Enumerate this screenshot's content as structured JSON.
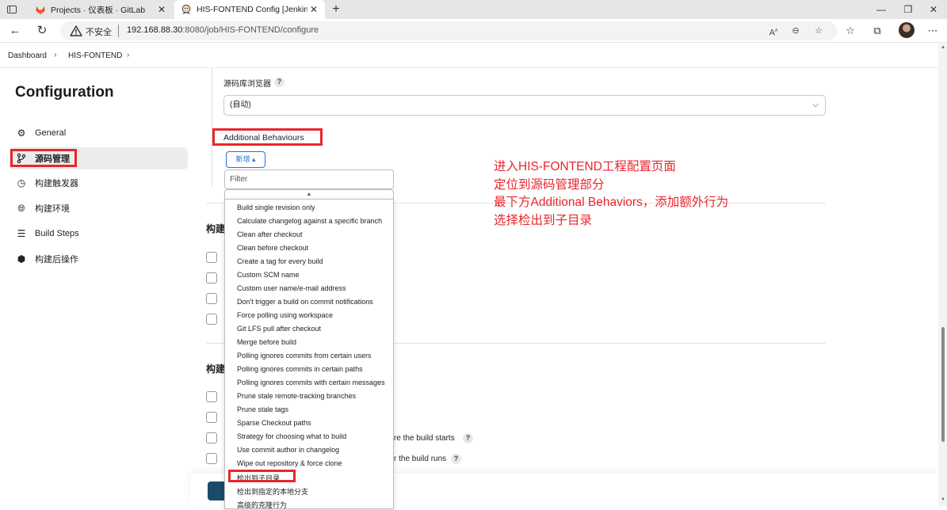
{
  "browser": {
    "tabs": [
      {
        "title": "Projects · 仪表板 · GitLab",
        "favicon": "gitlab-fox-icon"
      },
      {
        "title": "HIS-FONTEND Config [Jenkins]",
        "favicon": "jenkins-butler-icon"
      }
    ],
    "address": {
      "insecure_label": "不安全",
      "host": "192.168.88.30",
      "path": ":8080/job/HIS-FONTEND/configure"
    }
  },
  "breadcrumb": {
    "items": [
      "Dashboard",
      "HIS-FONTEND"
    ]
  },
  "sidebar": {
    "title": "Configuration",
    "items": [
      {
        "label": "General",
        "icon": "gear-icon"
      },
      {
        "label": "源码管理",
        "icon": "branch-icon",
        "active": true
      },
      {
        "label": "构建触发器",
        "icon": "clock-icon"
      },
      {
        "label": "构建环境",
        "icon": "globe-icon"
      },
      {
        "label": "Build Steps",
        "icon": "list-icon"
      },
      {
        "label": "构建后操作",
        "icon": "cube-icon"
      }
    ]
  },
  "scm": {
    "browser_label": "源码库浏览器",
    "browser_value": "(自动)",
    "additional_behaviours": "Additional Behaviours",
    "add_button": "新增 ▴",
    "filter_placeholder": "Filter",
    "options": [
      "Build single revision only",
      "Calculate changelog against a specific branch",
      "Clean after checkout",
      "Clean before checkout",
      "Create a tag for every build",
      "Custom SCM name",
      "Custom user name/e-mail address",
      "Don't trigger a build on commit notifications",
      "Force polling using workspace",
      "Git LFS pull after checkout",
      "Merge before build",
      "Polling ignores commits from certain users",
      "Polling ignores commits in certain paths",
      "Polling ignores commits with certain messages",
      "Prune stale remote-tracking branches",
      "Prune stale tags",
      "Sparse Checkout paths",
      "Strategy for choosing what to build",
      "Use commit author in changelog",
      "Wipe out repository & force clone",
      "检出到子目录",
      "检出到指定的本地分支",
      "高级的克隆行为"
    ]
  },
  "sections": {
    "triggers_head": "构建",
    "env_head": "构建",
    "env_option_3_tail": "re the build starts",
    "env_option_4_tail": "r the build runs"
  },
  "annotation": {
    "lines": [
      "进入HIS-FONTEND工程配置页面",
      "定位到源码管理部分",
      "最下方Additional Behaviors，添加额外行为",
      "选择检出到子目录"
    ]
  },
  "colors": {
    "highlight_red": "#e8262d",
    "jenkins_blue": "#2a6fd1",
    "save_button": "#1b4a6b"
  }
}
